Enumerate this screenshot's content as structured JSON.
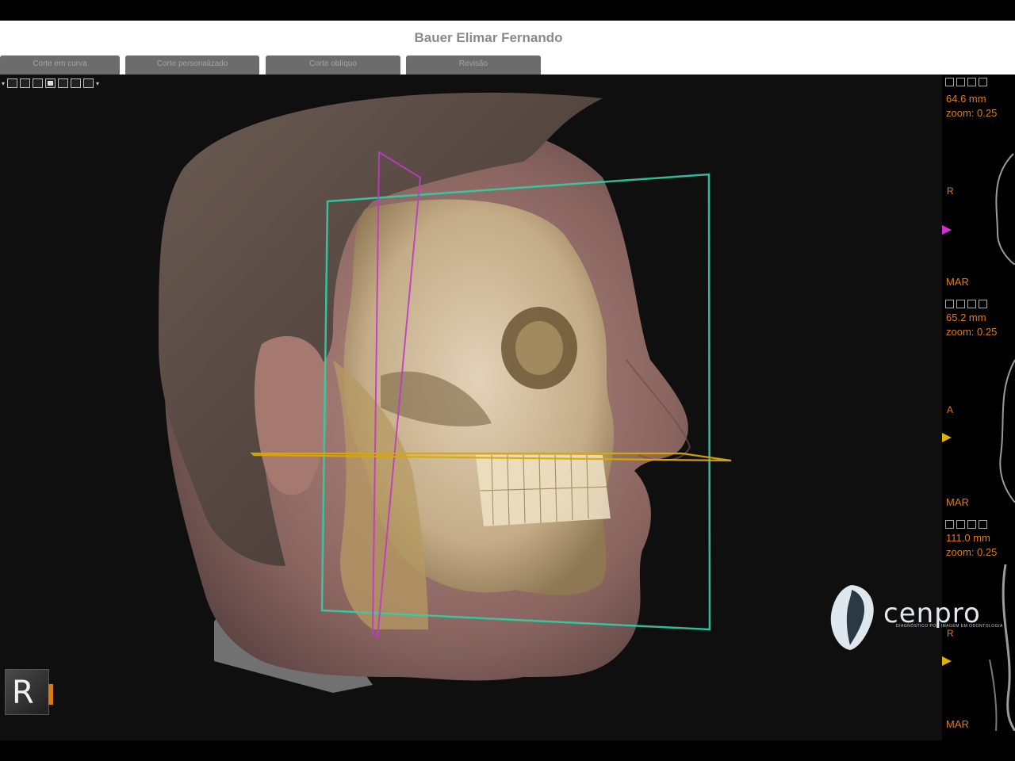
{
  "header": {
    "patient_name": "Bauer Elimar Fernando"
  },
  "tabs": [
    {
      "label": "Corte em curva"
    },
    {
      "label": "Corte personalizado"
    },
    {
      "label": "Corte oblíquo"
    },
    {
      "label": "Revisão"
    }
  ],
  "viewport": {
    "orientation_label": "R"
  },
  "side_panes": [
    {
      "distance": "64.6 mm",
      "zoom": "zoom: 0.25",
      "orientation": "R",
      "mar": "MAR",
      "marker_color": "#d22ed4"
    },
    {
      "distance": "65.2 mm",
      "zoom": "zoom: 0.25",
      "orientation": "A",
      "mar": "MAR",
      "marker_color": "#e0b000"
    },
    {
      "distance": "111.0 mm",
      "zoom": "zoom: 0.25",
      "orientation": "R",
      "mar": "MAR",
      "marker_color": "#e0b000"
    }
  ],
  "logo": {
    "name": "cenpro",
    "tagline": "DIAGNÓSTICO POR IMAGEM EM ODONTOLOGIA"
  },
  "colors": {
    "accent_orange": "#e07b1e",
    "plane_cyan": "#2fd0a8",
    "plane_magenta": "#c03ac4",
    "plane_yellow": "#d9a800"
  }
}
